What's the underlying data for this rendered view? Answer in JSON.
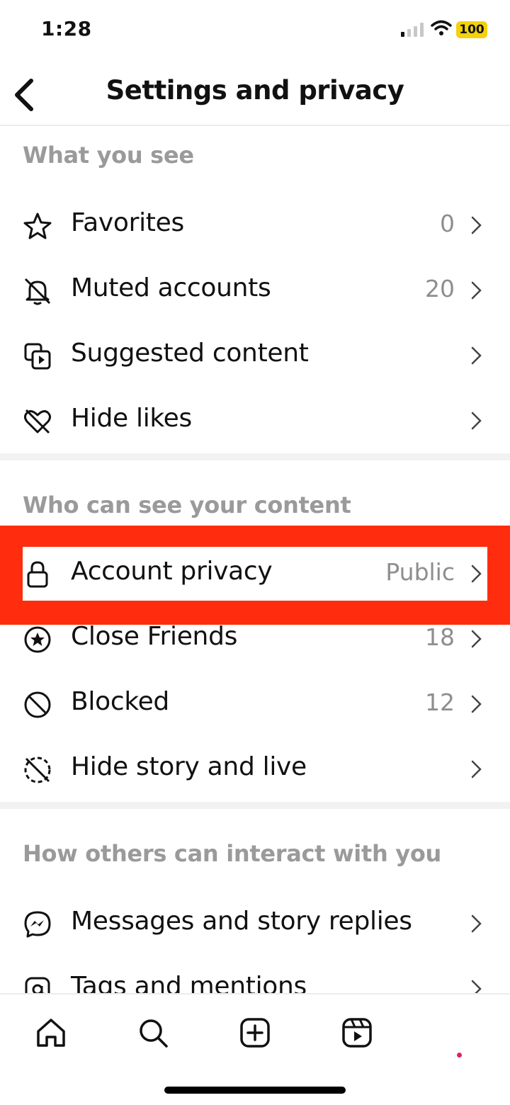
{
  "status_bar": {
    "time": "1:28",
    "battery": "100"
  },
  "header": {
    "title": "Settings and privacy"
  },
  "sections": [
    {
      "title": "What you see",
      "items": [
        {
          "label": "Favorites",
          "value": "0",
          "icon": "star-icon"
        },
        {
          "label": "Muted accounts",
          "value": "20",
          "icon": "muted-bell-icon"
        },
        {
          "label": "Suggested content",
          "value": "",
          "icon": "suggested-content-icon"
        },
        {
          "label": "Hide likes",
          "value": "",
          "icon": "hide-likes-icon"
        }
      ]
    },
    {
      "title": "Who can see your content",
      "items": [
        {
          "label": "Account privacy",
          "value": "Public",
          "icon": "lock-icon"
        },
        {
          "label": "Close Friends",
          "value": "18",
          "icon": "close-friends-star-icon"
        },
        {
          "label": "Blocked",
          "value": "12",
          "icon": "blocked-icon"
        },
        {
          "label": "Hide story and live",
          "value": "",
          "icon": "hide-story-icon"
        }
      ]
    },
    {
      "title": "How others can interact with you",
      "items": [
        {
          "label": "Messages and story replies",
          "value": "",
          "icon": "messenger-icon"
        },
        {
          "label": "Tags and mentions",
          "value": "",
          "icon": "at-sign-icon"
        }
      ]
    }
  ],
  "bottom_nav": [
    "home-icon",
    "search-icon",
    "create-icon",
    "reels-icon",
    "profile-icon"
  ],
  "colors": {
    "highlight": "#ff2d0d",
    "section_title": "#9a9a9a",
    "value_text": "#8e8e8e",
    "battery": "#f4d10b"
  }
}
